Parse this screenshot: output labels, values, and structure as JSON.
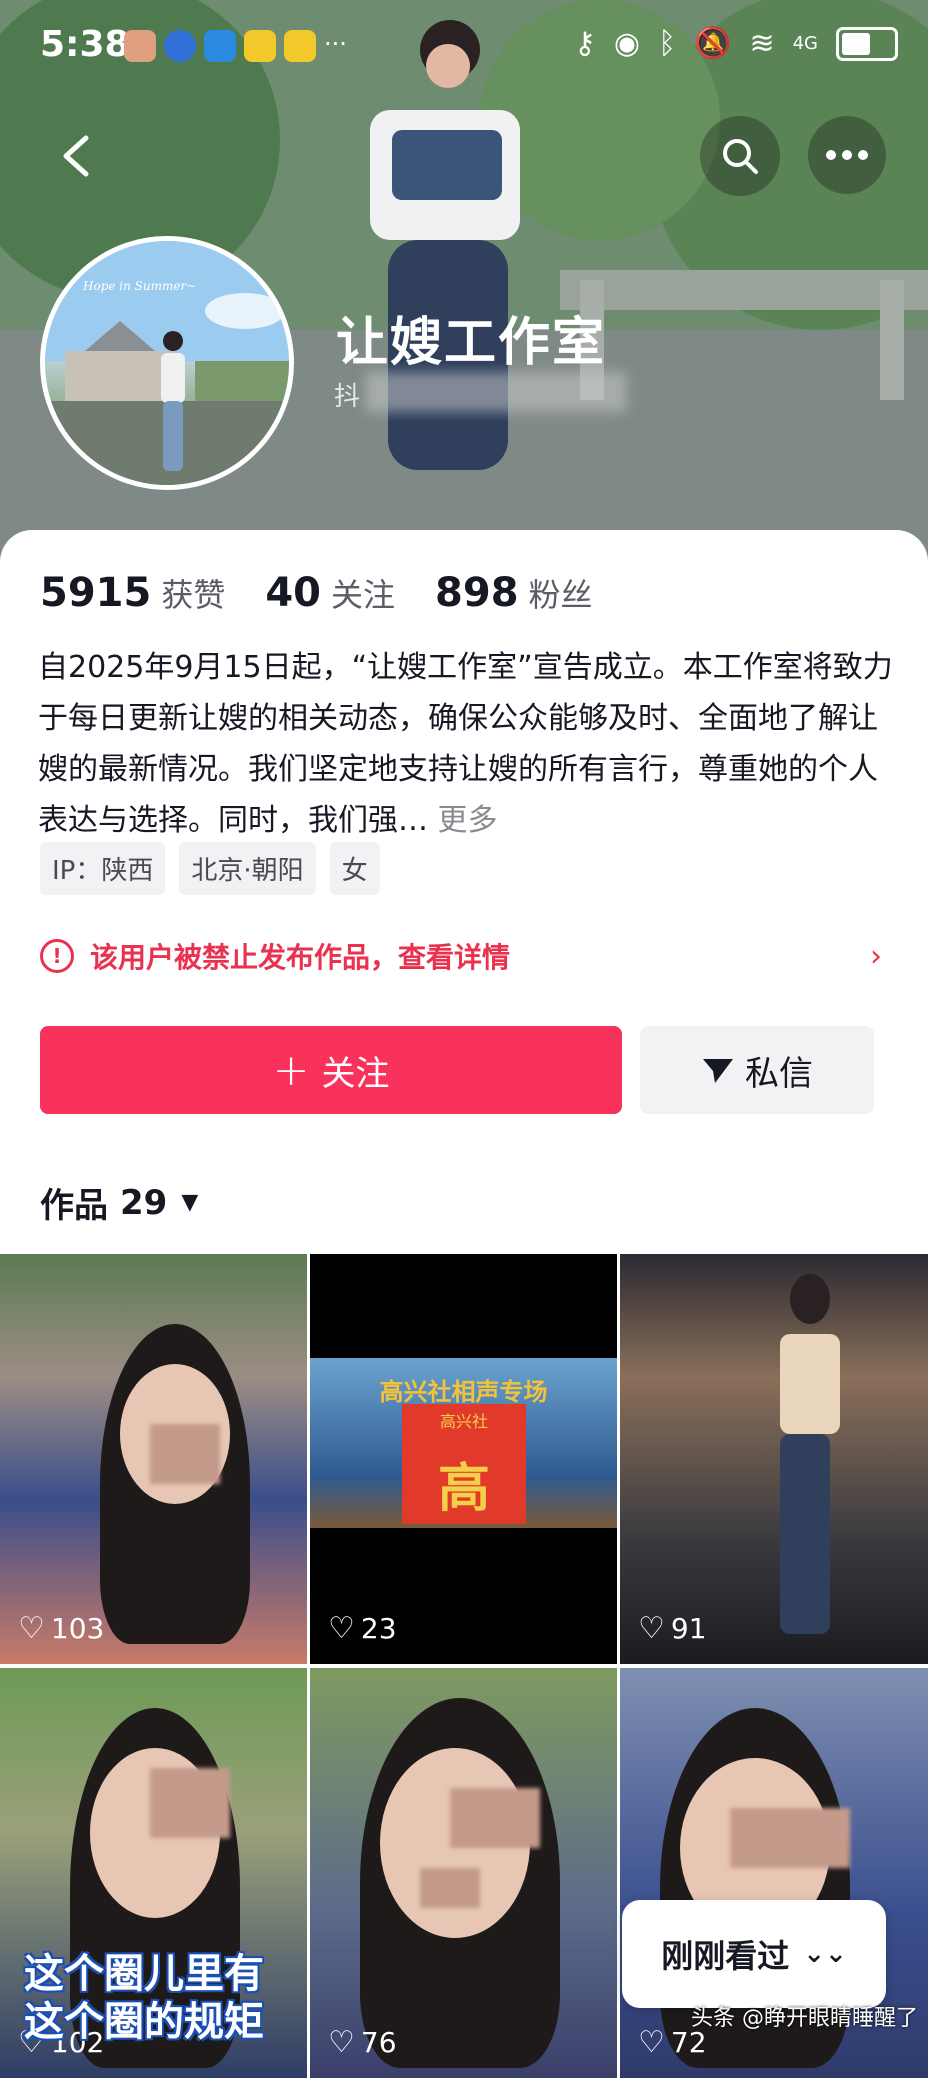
{
  "status": {
    "time": "5:38",
    "network": "4G"
  },
  "profile": {
    "name": "让嫂工作室",
    "id_prefix": "抖",
    "avatar_caption": "Hope in Summer~"
  },
  "stats": [
    {
      "value": "5915",
      "label": "获赞"
    },
    {
      "value": "40",
      "label": "关注"
    },
    {
      "value": "898",
      "label": "粉丝"
    }
  ],
  "bio": {
    "text": "自2025年9月15日起，“让嫂工作室”宣告成立。本工作室将致力于每日更新让嫂的相关动态，确保公众能够及时、全面地了解让嫂的最新情况。我们坚定地支持让嫂的所有言行，尊重她的个人表达与选择。同时，我们强…",
    "more": "更多"
  },
  "tags": [
    "IP：陕西",
    "北京·朝阳",
    "女"
  ],
  "notice": "该用户被禁止发布作品，查看详情",
  "actions": {
    "follow": "关注",
    "message": "私信"
  },
  "works": {
    "label": "作品",
    "count": "29"
  },
  "videos": [
    {
      "likes": "103"
    },
    {
      "likes": "23",
      "banner": "高兴社相声专场",
      "sign": "高兴社",
      "big": "高"
    },
    {
      "likes": "91"
    },
    {
      "likes": "102",
      "caption1": "这个圈儿里有",
      "caption2": "这个圈的规矩"
    },
    {
      "likes": "76"
    },
    {
      "likes": "72"
    }
  ],
  "recent": "刚刚看过",
  "watermark": "头条 @睁开眼睛睡醒了",
  "colors": {
    "accent": "#f9325b",
    "warning": "#e8324f"
  }
}
